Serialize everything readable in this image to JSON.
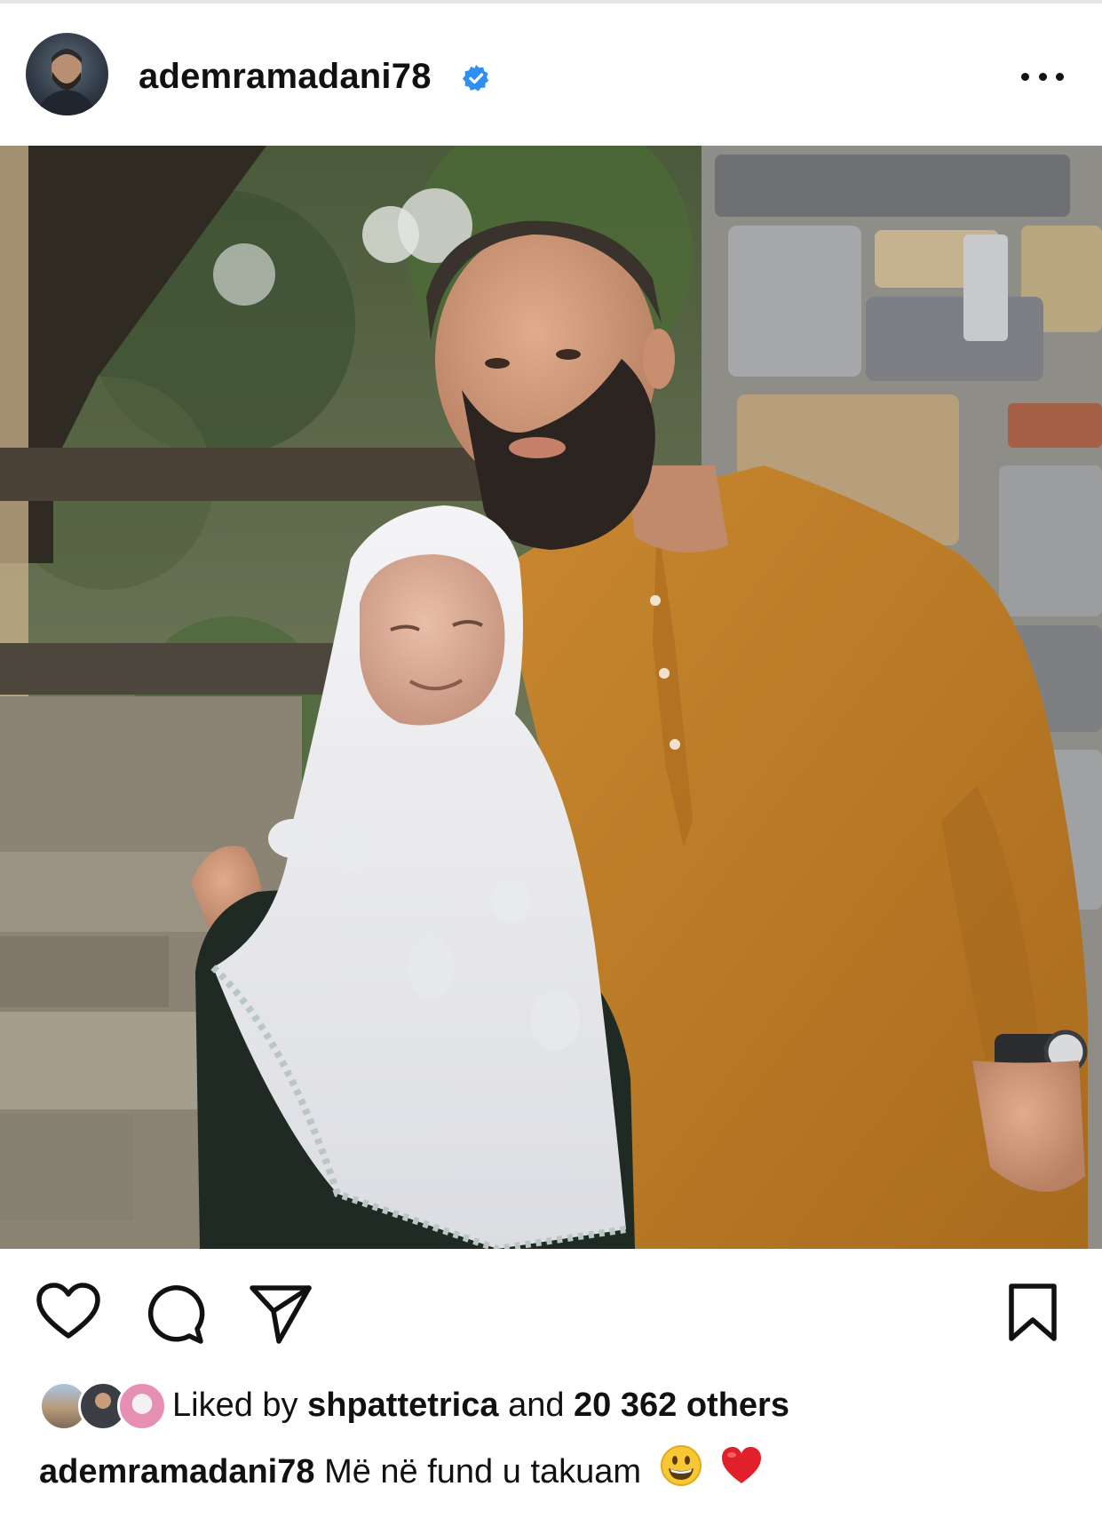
{
  "post": {
    "username": "ademramadani78",
    "verified": true,
    "more_icon": "more-horizontal-icon"
  },
  "photo": {
    "alt": "Photo post"
  },
  "actions": {
    "icons": [
      "heart-icon",
      "comment-icon",
      "share-icon",
      "bookmark-icon"
    ]
  },
  "likes": {
    "prefix": "Liked by",
    "liker": "shpattetrica",
    "joiner": "and",
    "others": "20 362 others"
  },
  "caption": {
    "username": "ademramadani78",
    "text": "Më në fund u takuam",
    "emojis": [
      "grinning-face",
      "red-heart"
    ]
  },
  "colors": {
    "verified_blue": "#2f8ff2",
    "heart_red": "#e0202a",
    "text": "#111111"
  }
}
